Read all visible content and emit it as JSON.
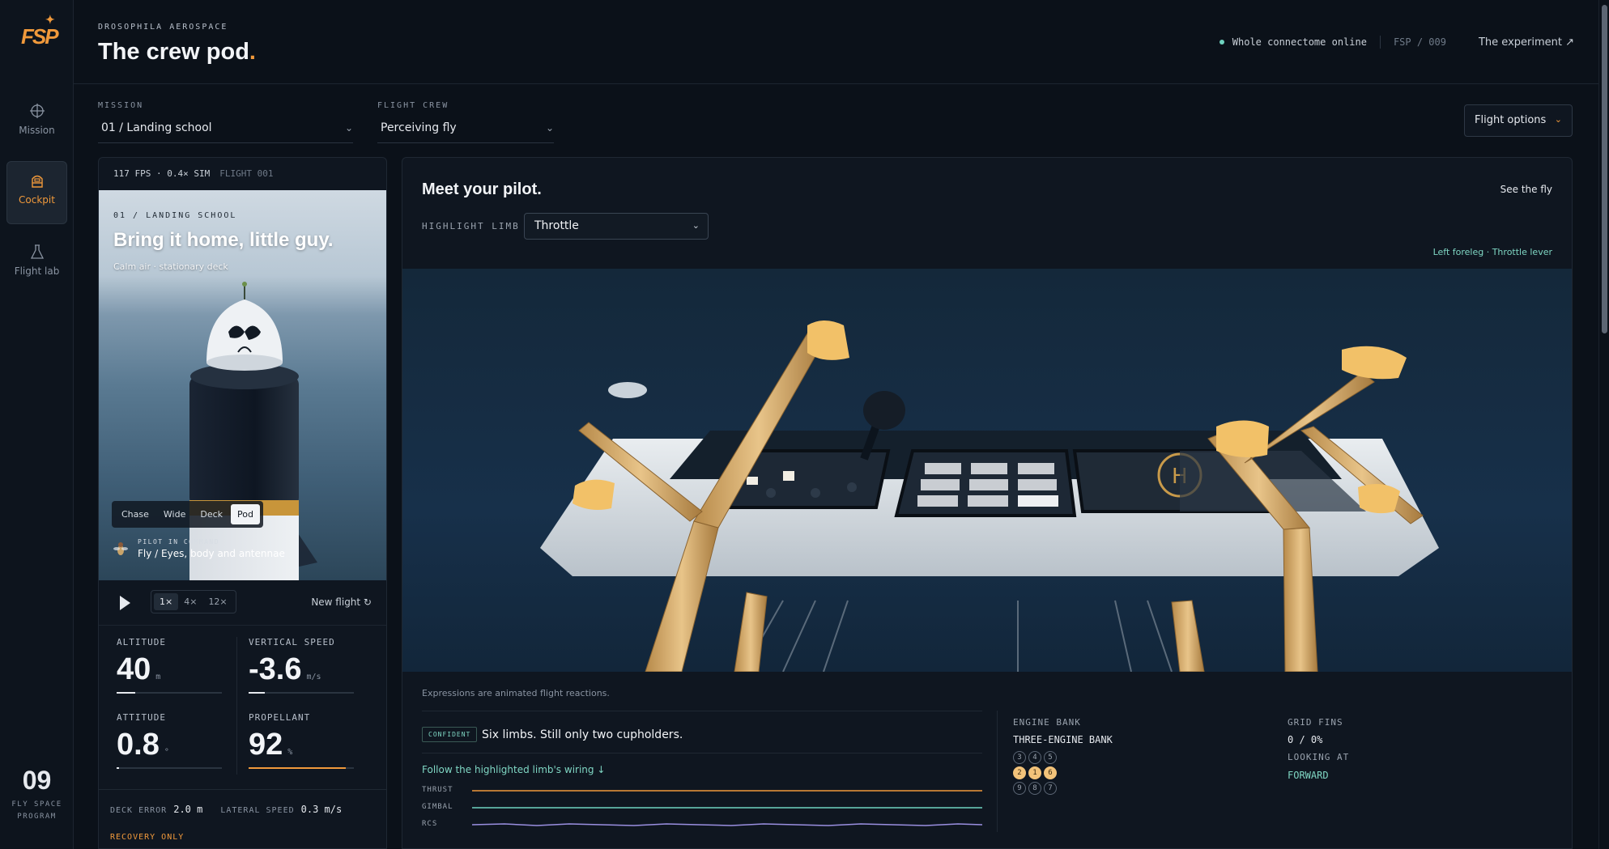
{
  "brand": {
    "logo": "FSP",
    "spark": "✦"
  },
  "rail": {
    "items": [
      {
        "label": "Mission",
        "icon": "crosshair-icon"
      },
      {
        "label": "Cockpit",
        "icon": "cockpit-icon",
        "active": true
      },
      {
        "label": "Flight lab",
        "icon": "flask-icon"
      }
    ],
    "program_number": "09",
    "program_line1": "FLY SPACE",
    "program_line2": "PROGRAM"
  },
  "header": {
    "eyebrow": "DROSOPHILA AEROSPACE",
    "title": "The crew pod",
    "title_dot": ".",
    "status": "Whole connectome online",
    "code": "FSP / 009",
    "link": "The experiment ↗"
  },
  "selectors": {
    "mission_label": "MISSION",
    "mission_value": "01 / Landing school",
    "crew_label": "FLIGHT CREW",
    "crew_value": "Perceiving fly",
    "options_button": "Flight options"
  },
  "sim": {
    "fps": "117 FPS · 0.4× SIM",
    "flight_id": "FLIGHT 001",
    "eyebrow": "01 / LANDING SCHOOL",
    "title": "Bring it home, little guy.",
    "subtitle": "Calm air · stationary deck",
    "camera_tabs": [
      "Chase",
      "Wide",
      "Deck",
      "Pod"
    ],
    "active_camera": "Pod",
    "pilot_label": "PILOT IN COMMAND",
    "pilot_value": "Fly / Eyes, body and antennae",
    "speeds": [
      "1×",
      "4×",
      "12×"
    ],
    "active_speed": "1×",
    "new_flight": "New flight ↻"
  },
  "metrics": {
    "altitude": {
      "label": "ALTITUDE",
      "value": "40",
      "unit": "m",
      "fill": 0.18
    },
    "vertical_speed": {
      "label": "VERTICAL SPEED",
      "value": "-3.6",
      "unit": "m/s",
      "fill": 0.15
    },
    "attitude": {
      "label": "ATTITUDE",
      "value": "0.8",
      "unit": "°",
      "fill": 0.02
    },
    "propellant": {
      "label": "PROPELLANT",
      "value": "92",
      "unit": "%",
      "fill": 0.92
    },
    "deck_error_label": "DECK ERROR",
    "deck_error_value": "2.0 m",
    "lateral_speed_label": "LATERAL SPEED",
    "lateral_speed_value": "0.3 m/s",
    "recovery": "RECOVERY ONLY"
  },
  "pilot_panel": {
    "title": "Meet your pilot.",
    "see_fly": "See the fly",
    "highlight_label": "HIGHLIGHT LIMB",
    "highlight_value": "Throttle",
    "limb_caption": "Left foreleg · Throttle lever",
    "expressions_note": "Expressions are animated flight reactions.",
    "mood_badge": "CONFIDENT",
    "quote": "Six limbs. Still only two cupholders.",
    "follow_link": "Follow the highlighted limb's wiring ↓",
    "traces": [
      {
        "label": "THRUST",
        "color": "#f0993b"
      },
      {
        "label": "GIMBAL",
        "color": "#6fd3c0"
      },
      {
        "label": "RCS",
        "color": "#9a8fe0"
      }
    ],
    "engine_bank_label": "ENGINE BANK",
    "engine_bank_value": "THREE-ENGINE BANK",
    "engines": [
      [
        {
          "n": "3",
          "on": false
        },
        {
          "n": "4",
          "on": false
        },
        {
          "n": "5",
          "on": false
        }
      ],
      [
        {
          "n": "2",
          "on": true
        },
        {
          "n": "1",
          "on": true
        },
        {
          "n": "6",
          "on": true
        }
      ],
      [
        {
          "n": "9",
          "on": false
        },
        {
          "n": "8",
          "on": false
        },
        {
          "n": "7",
          "on": false
        }
      ]
    ],
    "grid_fins_label": "GRID FINS",
    "grid_fins_value": "0 / 0%",
    "looking_label": "LOOKING AT",
    "looking_value": "FORWARD"
  }
}
